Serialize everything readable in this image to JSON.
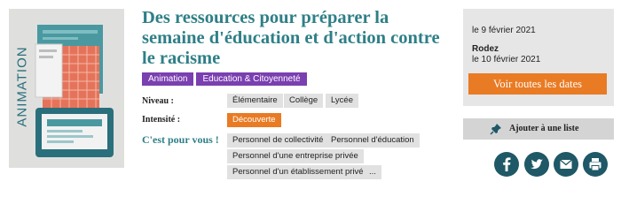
{
  "thumbnail": {
    "label": "ANIMATION",
    "icon": "laptop-illustration"
  },
  "title": "Des ressources pour préparer la semaine d'éducation et d'action contre le racisme",
  "tags": [
    "Animation",
    "Education & Citoyenneté"
  ],
  "niveau": {
    "label": "Niveau :",
    "values": [
      "Élémentaire",
      "Collège",
      "Lycée"
    ]
  },
  "intensite": {
    "label": "Intensité :",
    "value": "Découverte"
  },
  "pour_vous": {
    "label": "C'est pour vous !",
    "values": [
      "Personnel de collectivité",
      "Personnel d'éducation",
      "Personnel d'une entreprise privée",
      "Personnel d'un établissement privé",
      "..."
    ]
  },
  "dates": {
    "first": "le 9 février 2021",
    "city": "Rodez",
    "second": "le 10 février 2021",
    "button": "Voir toutes les dates"
  },
  "add_list": {
    "label": "Ajouter à une liste",
    "icon": "pin-icon"
  },
  "share_icons": [
    "facebook-icon",
    "twitter-icon",
    "email-icon",
    "print-icon"
  ],
  "colors": {
    "teal": "#2e7f87",
    "purple": "#7a3fb0",
    "orange": "#e97b24",
    "dark_teal": "#1f5866"
  }
}
